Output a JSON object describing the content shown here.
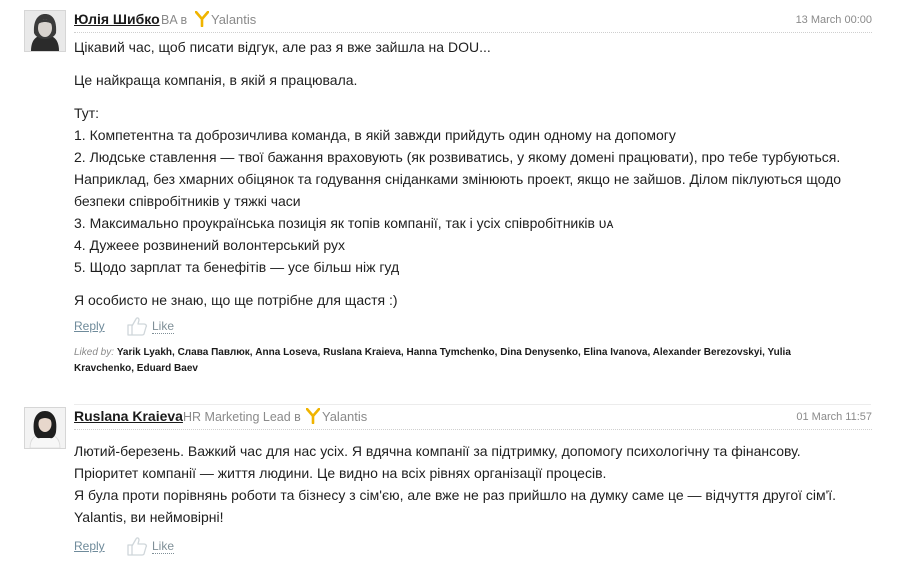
{
  "comments": [
    {
      "author": "Юлія Шибко",
      "role": "BA в",
      "company": "Yalantis",
      "date": "13 March 00:00",
      "paragraphs": [
        [
          "Цікавий час, щоб писати відгук, але раз я вже зайшла на DOU..."
        ],
        [
          "Це найкраща компанія, в якій я працювала."
        ],
        [
          "Тут:",
          "1. Компетентна та доброзичлива команда, в якій завжди прийдуть один одному на допомогу",
          "2. Людське ставлення — твої бажання враховують (як розвиватись, у якому домені працювати), про тебе турбуються.",
          "Наприклад, без хмарних обіцянок та годування сніданками змінюють проект, якщо не зайшов. Ділом піклуються щодо",
          "безпеки співробітників у тяжкі часи",
          "3. Максимально проукраїнська позиція як топів компанії, так і усіх співробітників ᴜᴀ",
          "4. Дужеее розвинений волонтерський рух",
          "5. Щодо зарплат та бенефітів — усе більш ніж гуд"
        ],
        [
          "Я особисто не знаю, що ще потрібне для щастя :)"
        ]
      ],
      "reply_label": "Reply",
      "like_label": "Like",
      "liked_by_label": "Liked by:",
      "liked_by_line1": "Yarik Lyakh, Слава Павлюк, Anna Loseva, Ruslana Kraieva, Hanna Tymchenko, Dina Denysenko, Elina Ivanova, Alexander Berezovskyi, Yulia",
      "liked_by_line2": "Kravchenko, Eduard Baev"
    },
    {
      "author": "Ruslana Kraieva",
      "role": "HR Marketing Lead в",
      "company": "Yalantis",
      "date": "01 March 11:57",
      "paragraphs": [
        [
          "Лютий-березень. Важкий час для нас усіх. Я вдячна компанії за підтримку, допомогу психологічну та фінансову.",
          "Пріоритет компанії — життя людини. Це видно на всіх рівнях організації процесів.",
          "Я була проти порівнянь роботи та бізнесу з сім'єю, але вже не раз прийшло на думку саме це — відчуття другої сім'ї.",
          "Yalantis, ви неймовірні!"
        ]
      ],
      "reply_label": "Reply",
      "like_label": "Like"
    }
  ],
  "icons": {
    "company_logo": "yalantis-y-logo",
    "like": "thumbs-up-outline-icon"
  },
  "colors": {
    "accent_logo": "#f0b400",
    "link": "#6f8b9b",
    "meta": "#8a8a8a"
  }
}
